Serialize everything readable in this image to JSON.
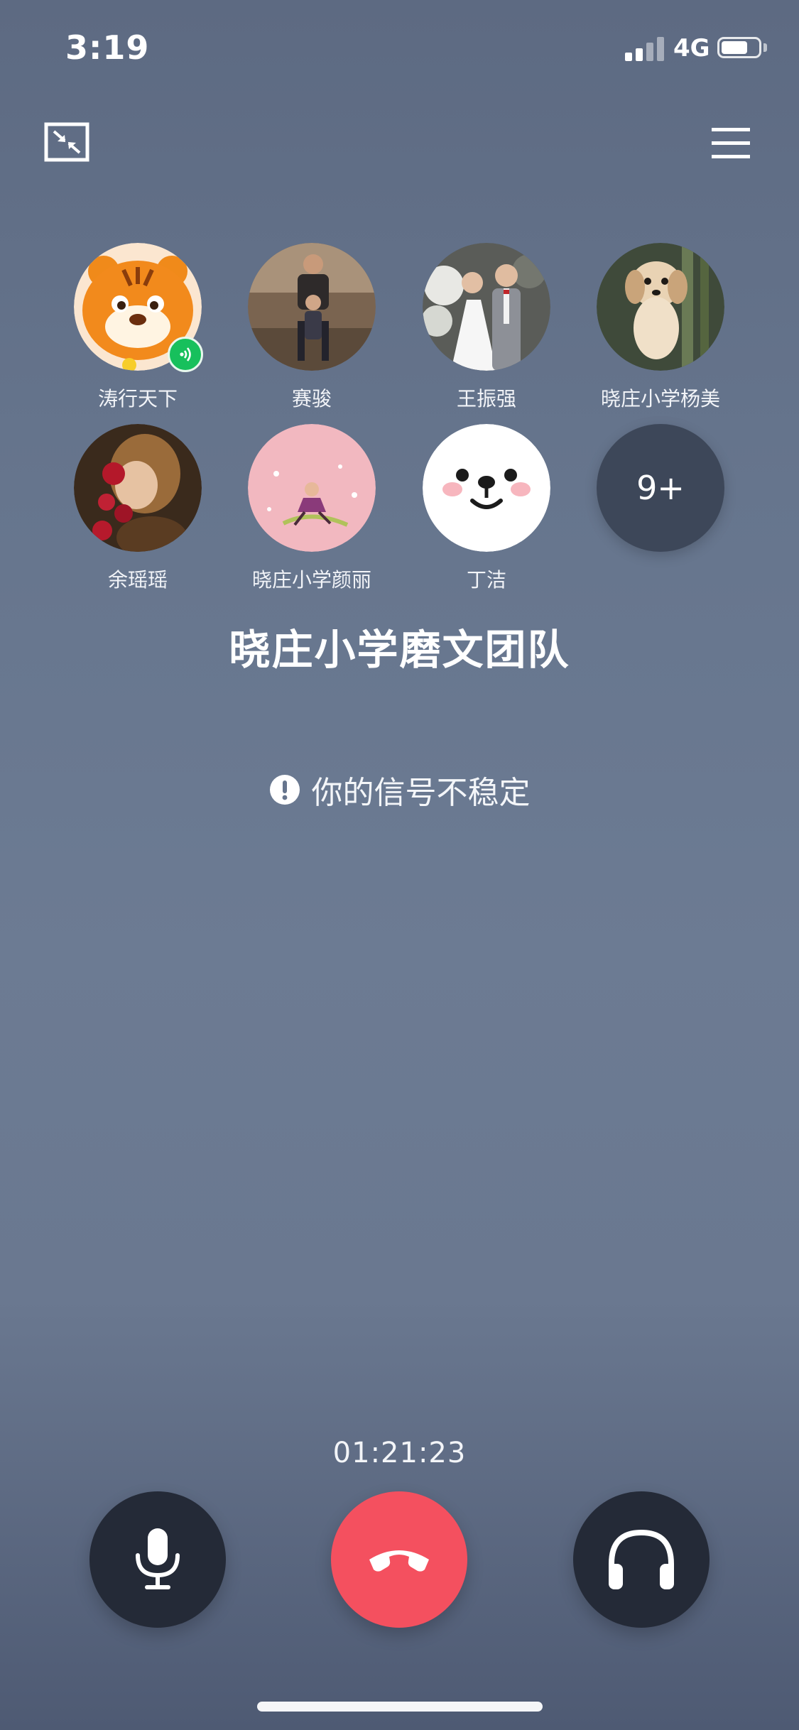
{
  "status_bar": {
    "time": "3:19",
    "network": "4G"
  },
  "header": {
    "minimize_icon": "minimize-window-icon",
    "menu_icon": "hamburger-menu-icon"
  },
  "participants": [
    {
      "name": "涛行天下",
      "speaking": true
    },
    {
      "name": "赛骏",
      "speaking": false
    },
    {
      "name": "王振强",
      "speaking": false
    },
    {
      "name": "晓庄小学杨美",
      "speaking": false
    },
    {
      "name": "余瑶瑶",
      "speaking": false
    },
    {
      "name": "晓庄小学颜丽",
      "speaking": false
    },
    {
      "name": "丁洁",
      "speaking": false
    }
  ],
  "more_count": "9+",
  "group_name": "晓庄小学磨文团队",
  "warning_text": "你的信号不稳定",
  "call_duration": "01:21:23",
  "controls": {
    "mic_icon": "microphone-icon",
    "hangup_icon": "hang-up-phone-icon",
    "speaker_icon": "headphones-icon"
  },
  "colors": {
    "hangup": "#f4505f",
    "control_dark": "#242a37",
    "speaking": "#17c05c"
  }
}
